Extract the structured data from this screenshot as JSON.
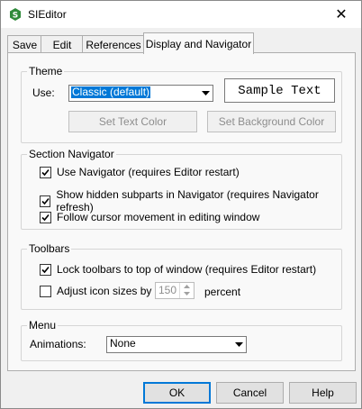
{
  "window": {
    "title": "SIEditor"
  },
  "tabs": [
    {
      "label": "Save"
    },
    {
      "label": "Edit"
    },
    {
      "label": "References"
    },
    {
      "label": "Display and Navigator"
    }
  ],
  "theme": {
    "legend": "Theme",
    "use_label": "Use:",
    "selected": "Classic (default)",
    "sample_text": "Sample Text",
    "set_text_color": "Set Text Color",
    "set_background_color": "Set Background Color"
  },
  "navigator": {
    "legend": "Section Navigator",
    "options": [
      {
        "label": "Use Navigator (requires Editor restart)",
        "checked": true
      },
      {
        "label": "Show hidden subparts in Navigator (requires Navigator refresh)",
        "checked": true
      },
      {
        "label": "Follow cursor movement in editing window",
        "checked": true
      }
    ]
  },
  "toolbars": {
    "legend": "Toolbars",
    "lock_label": "Lock toolbars to top of window (requires Editor restart)",
    "lock_checked": true,
    "adjust_label": "Adjust icon sizes by",
    "adjust_checked": false,
    "adjust_value": "150",
    "percent_label": "percent"
  },
  "menu": {
    "legend": "Menu",
    "animations_label": "Animations:",
    "animations_value": "None"
  },
  "buttons": {
    "ok": "OK",
    "cancel": "Cancel",
    "help": "Help"
  },
  "colors": {
    "accent": "#0078d7",
    "app_icon": "#2f8a3a"
  }
}
